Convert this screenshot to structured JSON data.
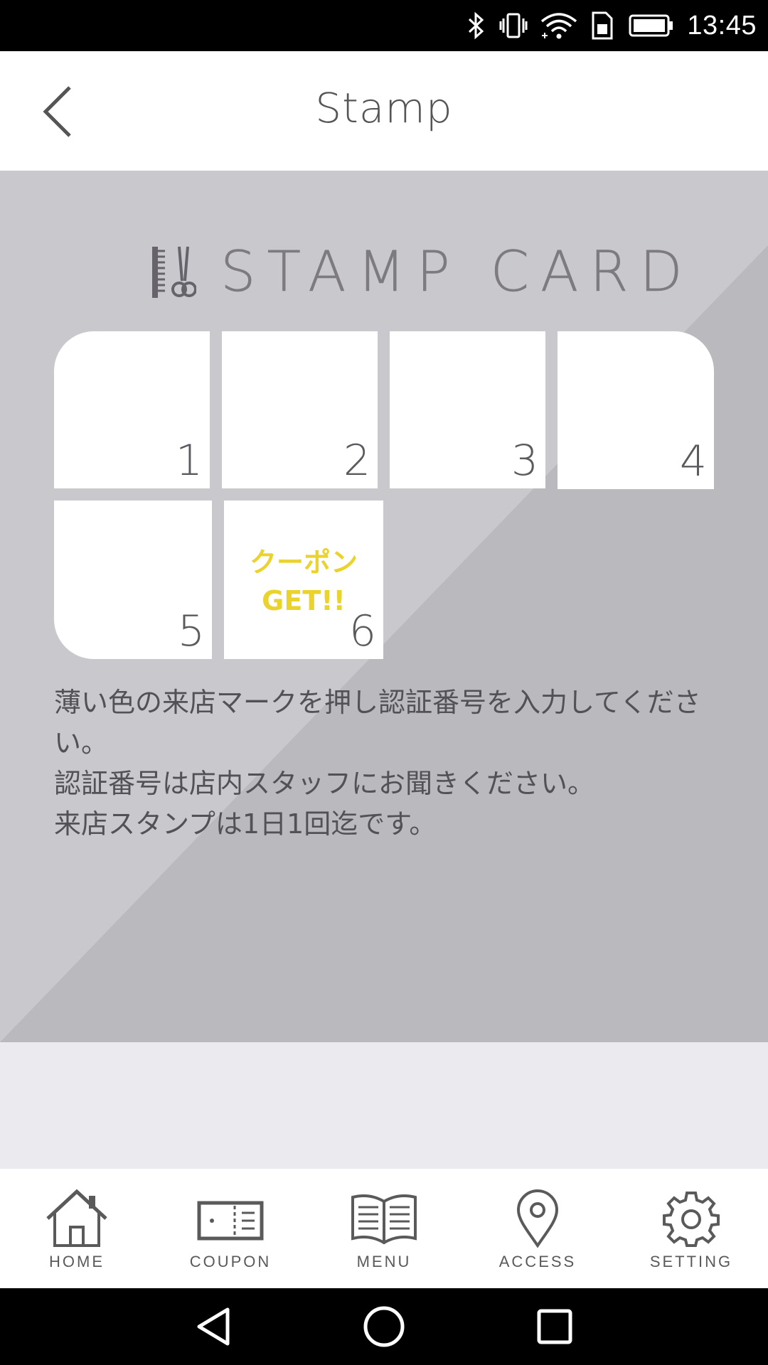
{
  "status_bar": {
    "time": "13:45",
    "icons": [
      "bluetooth-icon",
      "vibrate-icon",
      "wifi-icon",
      "sim-icon",
      "battery-icon"
    ]
  },
  "header": {
    "title": "Stamp",
    "back_icon": "chevron-left-icon"
  },
  "stamp_card": {
    "logo_text": "STAMP CARD",
    "logo_icon": "comb-scissors-icon",
    "stamps": [
      {
        "number": "1"
      },
      {
        "number": "2"
      },
      {
        "number": "3"
      },
      {
        "number": "4"
      },
      {
        "number": "5"
      },
      {
        "number": "6",
        "reward_line1": "クーポン",
        "reward_line2": "GET!!"
      }
    ],
    "instructions": [
      "薄い色の来店マークを押し認証番号を入力してください。",
      "認証番号は店内スタッフにお聞きください。",
      "来店スタンプは1日1回迄です。"
    ]
  },
  "bottom_nav": {
    "items": [
      {
        "label": "HOME",
        "icon": "home-icon"
      },
      {
        "label": "COUPON",
        "icon": "ticket-icon"
      },
      {
        "label": "MENU",
        "icon": "book-icon"
      },
      {
        "label": "ACCESS",
        "icon": "location-pin-icon"
      },
      {
        "label": "SETTING",
        "icon": "gear-icon"
      }
    ]
  },
  "android_nav": {
    "buttons": [
      "back-triangle-icon",
      "home-circle-icon",
      "recents-square-icon"
    ]
  },
  "colors": {
    "status_bar": "#000000",
    "header_bg": "#ffffff",
    "stamp_area": "#bab9bd",
    "coupon_text": "#ead32d",
    "text_dark": "#525155"
  }
}
